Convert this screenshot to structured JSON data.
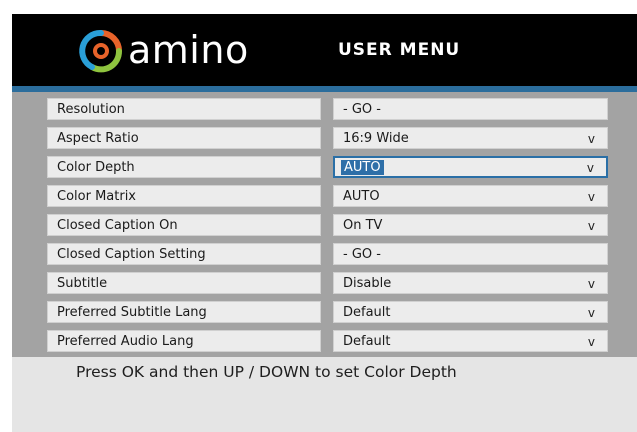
{
  "header": {
    "logo_text": "amino",
    "title": "USER MENU"
  },
  "menu": {
    "items": [
      {
        "label": "Resolution",
        "value": "- GO -",
        "has_arrow": false,
        "selected": false
      },
      {
        "label": "Aspect Ratio",
        "value": "16:9 Wide",
        "has_arrow": true,
        "selected": false
      },
      {
        "label": "Color Depth",
        "value": "AUTO",
        "has_arrow": true,
        "selected": true
      },
      {
        "label": "Color Matrix",
        "value": "AUTO",
        "has_arrow": true,
        "selected": false
      },
      {
        "label": "Closed Caption On",
        "value": "On TV",
        "has_arrow": true,
        "selected": false
      },
      {
        "label": "Closed Caption Setting",
        "value": "- GO -",
        "has_arrow": false,
        "selected": false
      },
      {
        "label": "Subtitle",
        "value": "Disable",
        "has_arrow": true,
        "selected": false
      },
      {
        "label": "Preferred Subtitle Lang",
        "value": "Default",
        "has_arrow": true,
        "selected": false
      },
      {
        "label": "Preferred Audio Lang",
        "value": "Default",
        "has_arrow": true,
        "selected": false
      }
    ],
    "arrow_glyph": "v"
  },
  "footer": {
    "hint": "Press OK and then UP / DOWN to set Color Depth"
  },
  "colors": {
    "header_bg": "#000000",
    "accent_blue": "#2b6d9c",
    "panel_bg": "#a3a3a3",
    "cell_bg": "#ececec",
    "selection": "#2e6fa8",
    "logo_orange": "#e8632a",
    "logo_green": "#8fc43f",
    "logo_blue": "#2a9fd8"
  }
}
